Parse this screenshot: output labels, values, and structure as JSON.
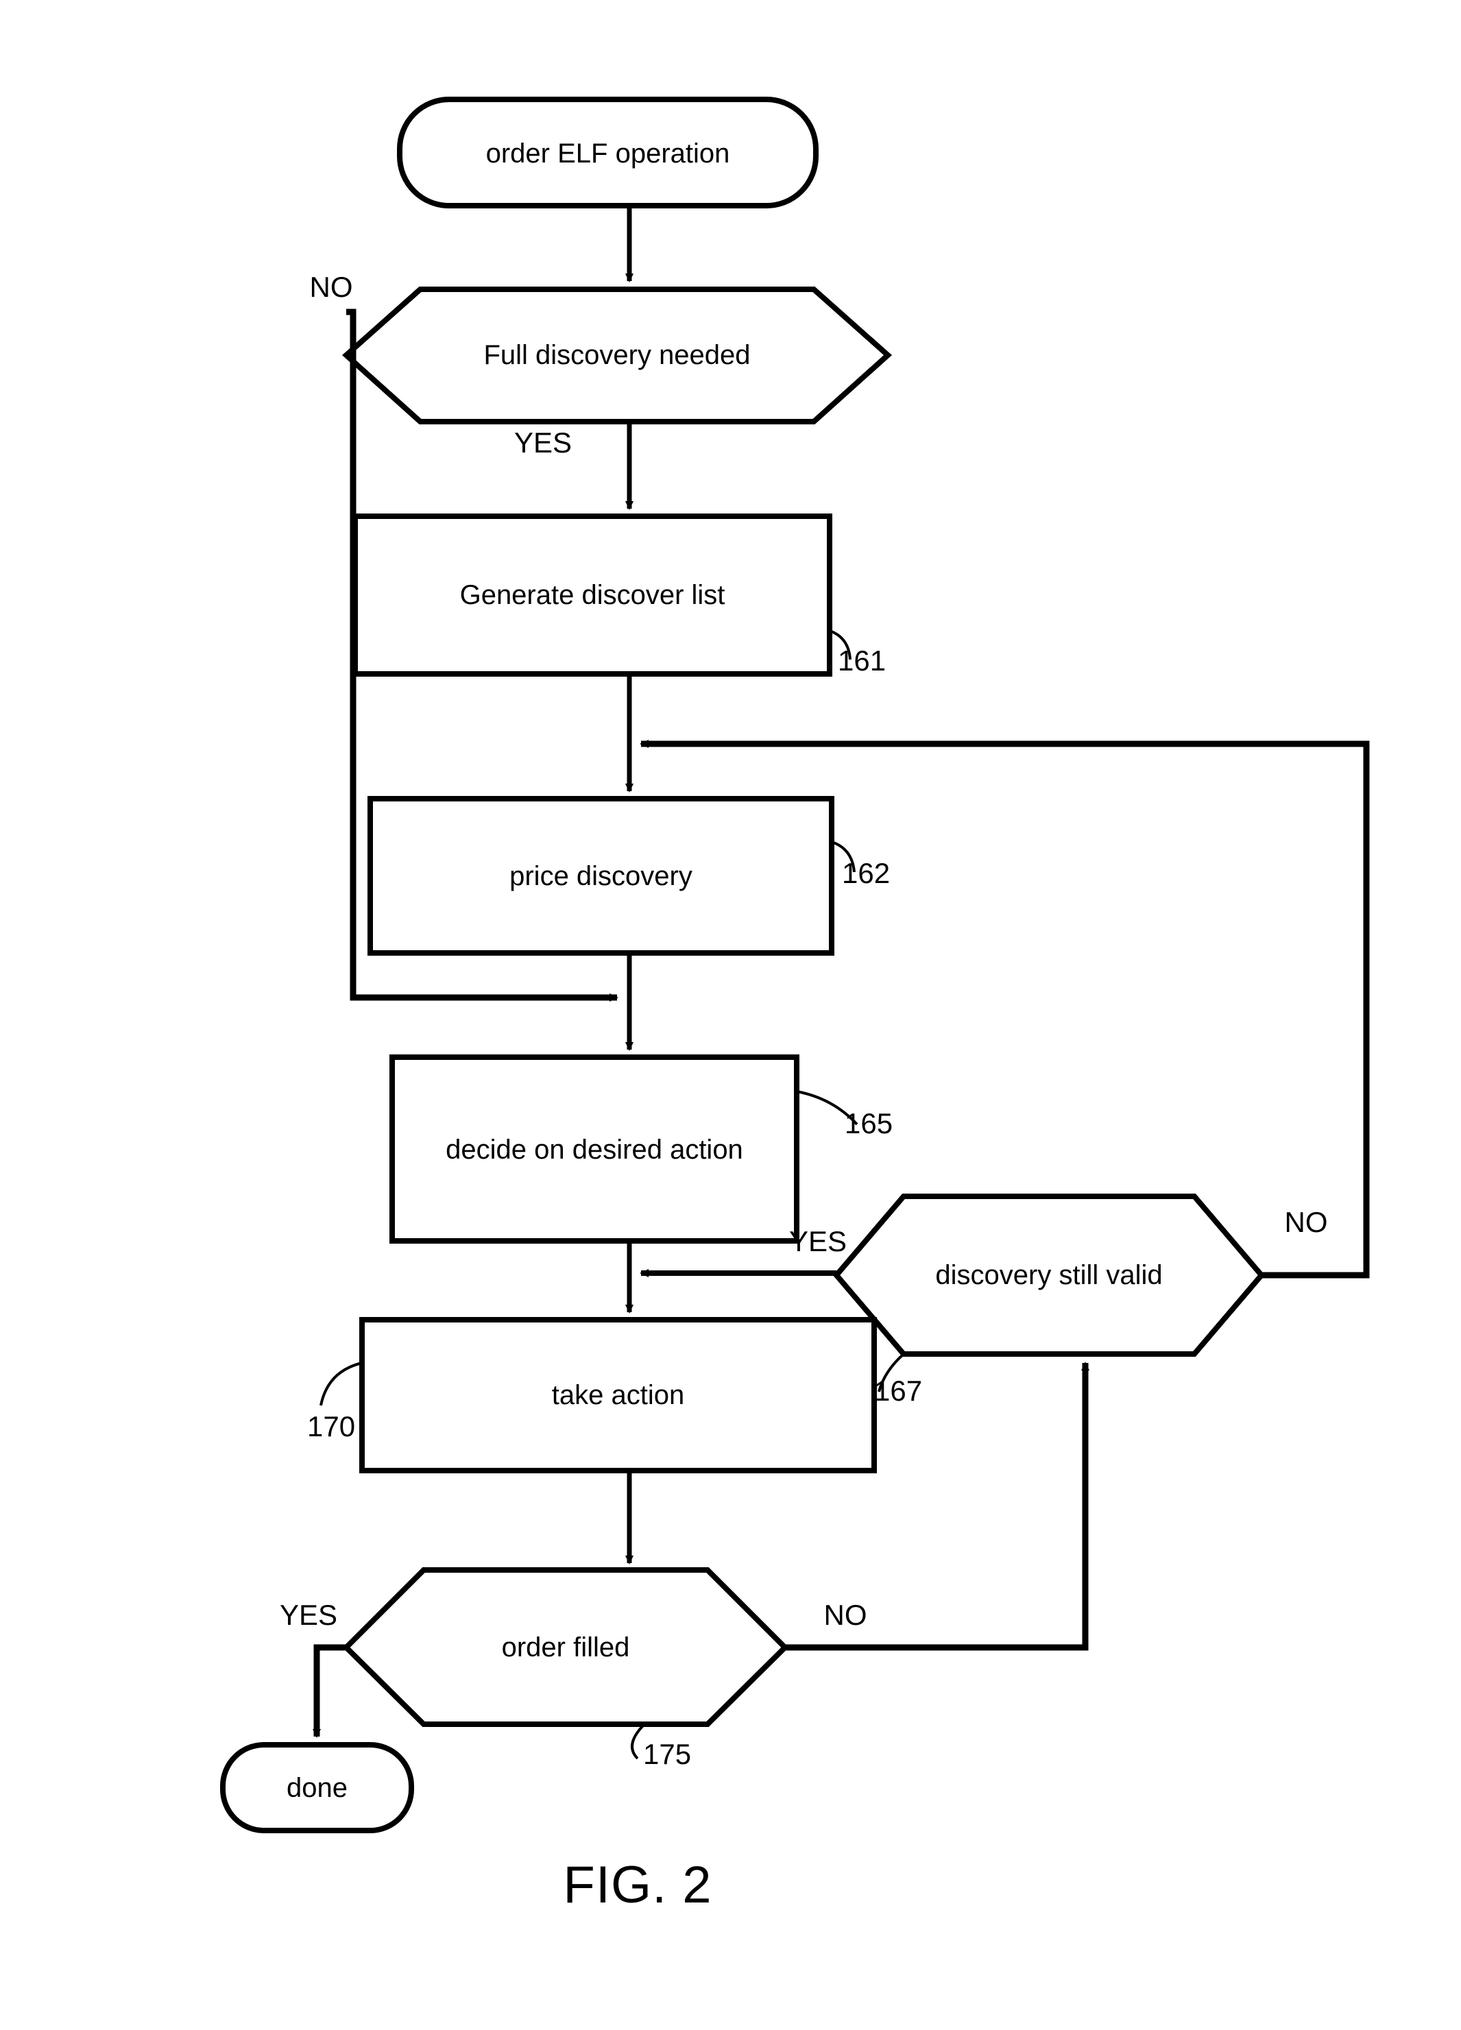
{
  "figure": {
    "caption": "FIG. 2",
    "title": "order ELF operation flowchart"
  },
  "nodes": {
    "start": {
      "label": "order ELF operation",
      "shape": "terminal"
    },
    "full_discovery": {
      "label": "Full discovery needed",
      "shape": "hexagon"
    },
    "generate_list": {
      "label": "Generate discover list",
      "shape": "process",
      "ref": "161"
    },
    "price_discovery": {
      "label": "price discovery",
      "shape": "process",
      "ref": "162"
    },
    "decide_action": {
      "label": "decide on desired action",
      "shape": "process",
      "ref": "165"
    },
    "discovery_valid": {
      "label": "discovery still valid",
      "shape": "hexagon",
      "ref": "167"
    },
    "take_action": {
      "label": "take action",
      "shape": "process",
      "ref": "170"
    },
    "order_filled": {
      "label": "order filled",
      "shape": "hexagon",
      "ref": "175"
    },
    "done": {
      "label": "done",
      "shape": "terminal"
    }
  },
  "edge_labels": {
    "full_discovery_no": "NO",
    "full_discovery_yes": "YES",
    "discovery_valid_yes": "YES",
    "discovery_valid_no": "NO",
    "order_filled_yes": "YES",
    "order_filled_no": "NO"
  },
  "reference_numerals": {
    "generate_list": "161",
    "price_discovery": "162",
    "decide_action": "165",
    "discovery_valid": "167",
    "take_action": "170",
    "order_filled": "175"
  },
  "colors": {
    "line": "#000000",
    "background": "#ffffff",
    "text": "#000000"
  }
}
